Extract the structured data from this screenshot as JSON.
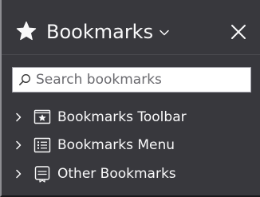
{
  "header": {
    "title": "Bookmarks",
    "title_icon": "star-icon",
    "dropdown_icon": "chevron-down-icon",
    "close_icon": "close-icon"
  },
  "search": {
    "placeholder": "Search bookmarks",
    "value": ""
  },
  "tree": {
    "items": [
      {
        "label": "Bookmarks Toolbar",
        "icon": "bookmarks-toolbar-icon"
      },
      {
        "label": "Bookmarks Menu",
        "icon": "bookmarks-menu-icon"
      },
      {
        "label": "Other Bookmarks",
        "icon": "other-bookmarks-icon"
      }
    ]
  },
  "colors": {
    "panel_background": "#38383d",
    "text": "#f9f9fa",
    "search_background": "#ffffff",
    "divider": "#4a4a4f"
  }
}
